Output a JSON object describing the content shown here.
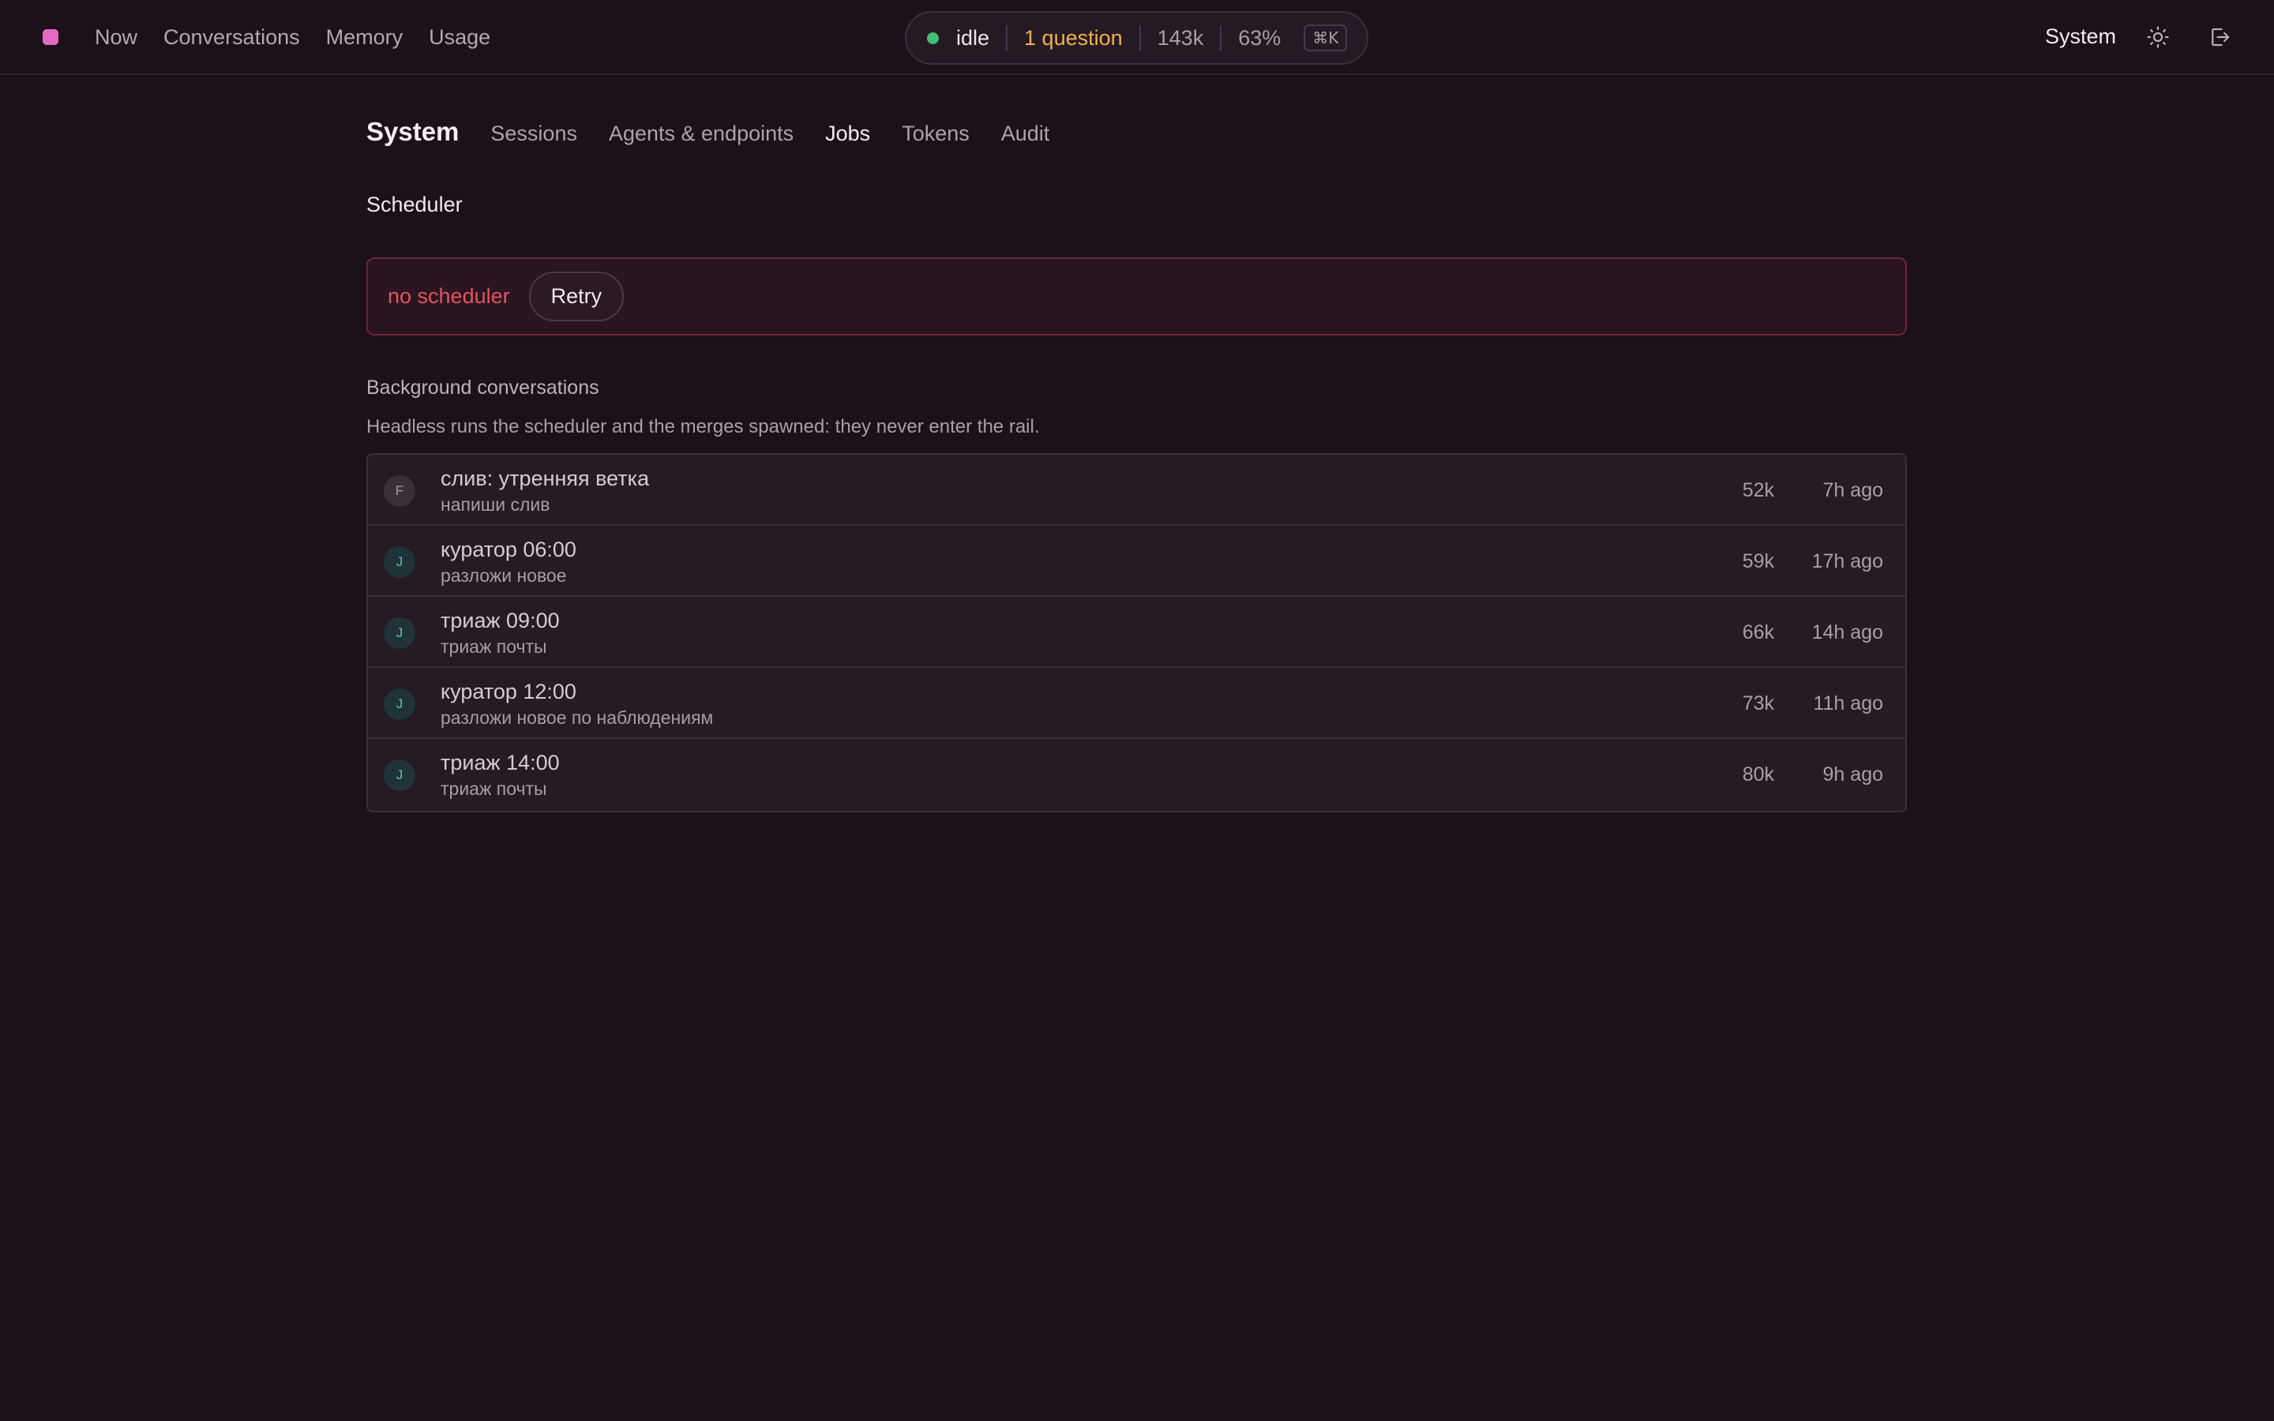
{
  "nav": {
    "items": [
      "Now",
      "Conversations",
      "Memory",
      "Usage"
    ]
  },
  "status": {
    "state": "idle",
    "questions": "1 question",
    "tokens": "143k",
    "percent": "63%",
    "shortcut": "⌘K",
    "state_color": "#3fbf74",
    "question_color": "#efb14a"
  },
  "header_right": {
    "section_label": "System",
    "theme_icon": "sun-icon",
    "logout_icon": "logout-icon"
  },
  "subnav": {
    "title": "System",
    "tabs": [
      "Sessions",
      "Agents & endpoints",
      "Jobs",
      "Tokens",
      "Audit"
    ],
    "active_tab": "Jobs"
  },
  "scheduler": {
    "title": "Scheduler",
    "error": "no scheduler",
    "retry_label": "Retry",
    "error_color": "#e0545f"
  },
  "background": {
    "title": "Background conversations",
    "description": "Headless runs the scheduler and the merges spawned: they never enter the rail.",
    "rows": [
      {
        "avatar": "F",
        "title": "слив: утренняя ветка",
        "subtitle": "напиши слив",
        "tokens": "52k",
        "ago": "7h ago"
      },
      {
        "avatar": "J",
        "title": "куратор 06:00",
        "subtitle": "разложи новое",
        "tokens": "59k",
        "ago": "17h ago"
      },
      {
        "avatar": "J",
        "title": "триаж 09:00",
        "subtitle": "триаж почты",
        "tokens": "66k",
        "ago": "14h ago"
      },
      {
        "avatar": "J",
        "title": "куратор 12:00",
        "subtitle": "разложи новое по наблюдениям",
        "tokens": "73k",
        "ago": "11h ago"
      },
      {
        "avatar": "J",
        "title": "триаж 14:00",
        "subtitle": "триаж почты",
        "tokens": "80k",
        "ago": "9h ago"
      }
    ]
  }
}
